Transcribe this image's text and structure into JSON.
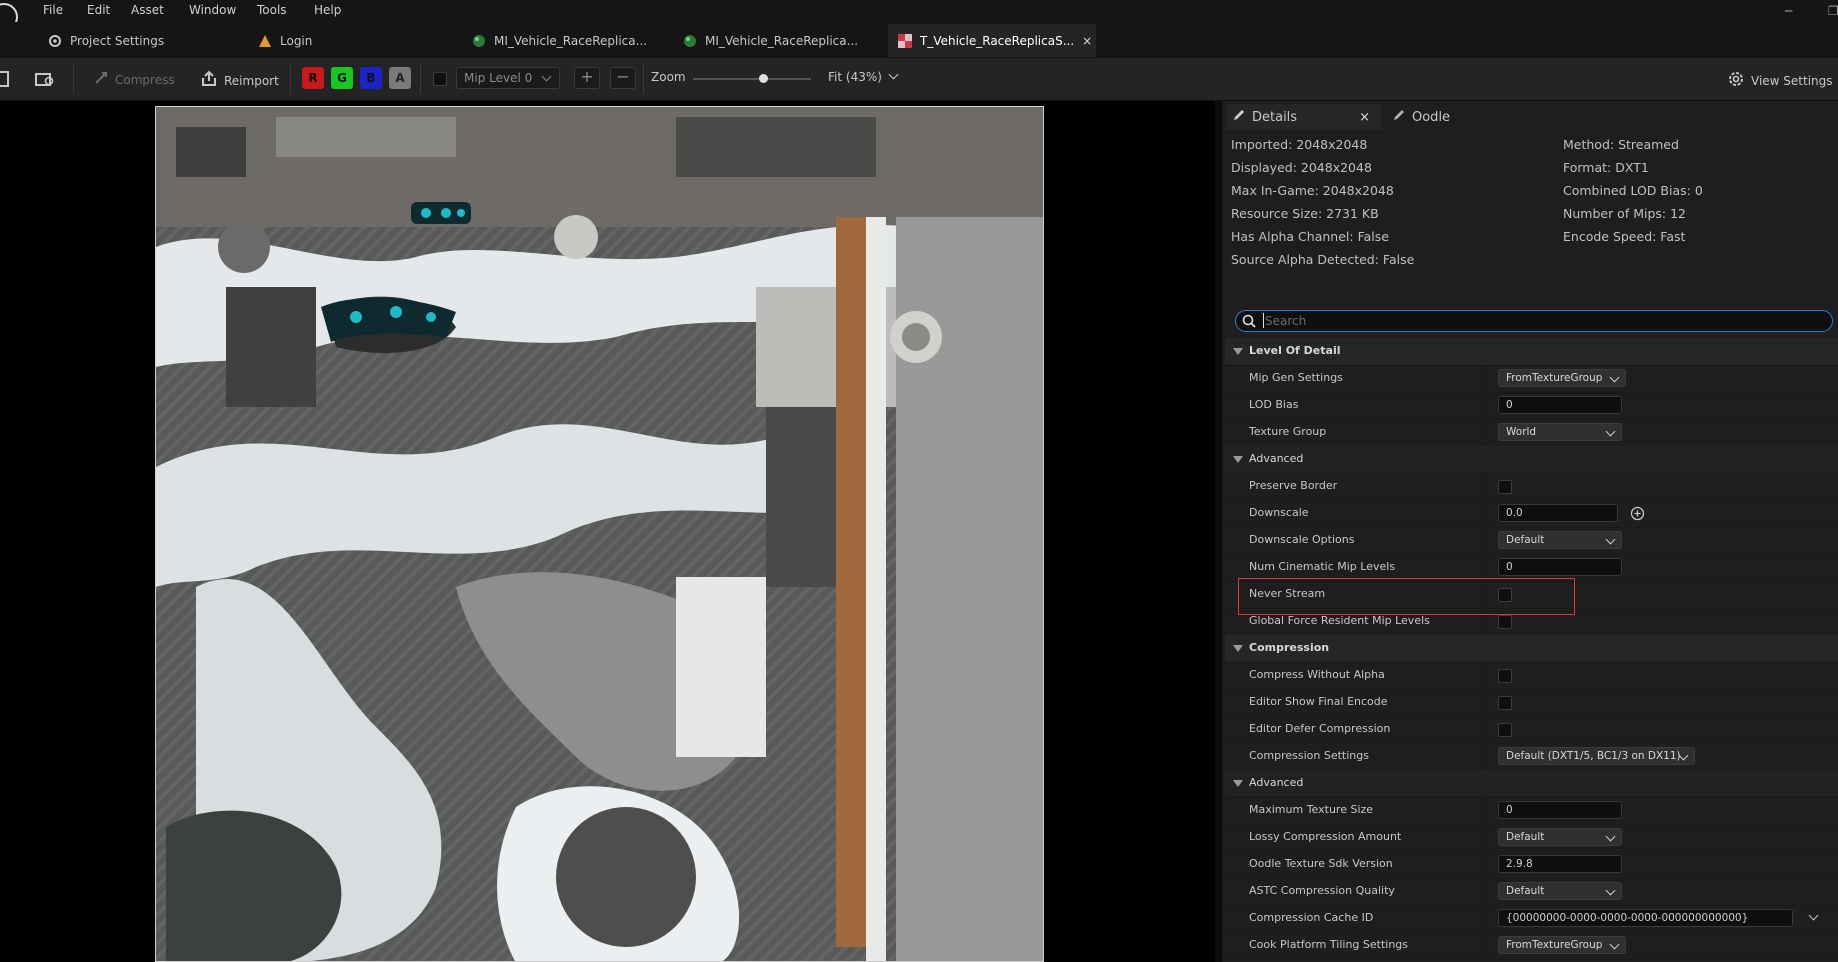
{
  "menu": {
    "items": [
      "File",
      "Edit",
      "Asset",
      "Window",
      "Tools",
      "Help"
    ]
  },
  "tabs": [
    {
      "label": "Project Settings"
    },
    {
      "label": "Login"
    },
    {
      "label": "MI_Vehicle_RaceReplica..."
    },
    {
      "label": "MI_Vehicle_RaceReplica..."
    },
    {
      "label": "T_Vehicle_RaceReplicaS...",
      "close": "×"
    }
  ],
  "toolbar": {
    "compress": "Compress",
    "reimport": "Reimport",
    "channels": [
      "R",
      "G",
      "B",
      "A"
    ],
    "mip_level": "Mip Level 0",
    "zoom_label": "Zoom",
    "zoom_value": 0.6,
    "fit": "Fit (43%)",
    "view_settings": "View Settings"
  },
  "panel_tabs": {
    "details": "Details",
    "details_close": "×",
    "oodle": "Oodle"
  },
  "info": {
    "left": [
      "Imported: 2048x2048",
      "Displayed: 2048x2048",
      "Max In-Game: 2048x2048",
      "Resource Size: 2731 KB",
      "Has Alpha Channel: False",
      "Source Alpha Detected: False"
    ],
    "right": [
      "Method: Streamed",
      "Format: DXT1",
      "Combined LOD Bias: 0",
      "Number of Mips: 12",
      "Encode Speed: Fast"
    ]
  },
  "search": {
    "placeholder": "Search"
  },
  "sections": {
    "lod": "Level Of Detail",
    "lod_advanced": "Advanced",
    "compression": "Compression",
    "comp_advanced": "Advanced"
  },
  "properties": {
    "mip_gen_settings": {
      "label": "Mip Gen Settings",
      "value": "FromTextureGroup"
    },
    "lod_bias": {
      "label": "LOD Bias",
      "value": "0"
    },
    "texture_group": {
      "label": "Texture Group",
      "value": "World"
    },
    "preserve_border": {
      "label": "Preserve Border"
    },
    "downscale": {
      "label": "Downscale",
      "value": "0.0"
    },
    "downscale_options": {
      "label": "Downscale Options",
      "value": "Default"
    },
    "num_cinematic_mip_levels": {
      "label": "Num Cinematic Mip Levels",
      "value": "0"
    },
    "never_stream": {
      "label": "Never Stream"
    },
    "global_force_resident": {
      "label": "Global Force Resident Mip Levels"
    },
    "compress_without_alpha": {
      "label": "Compress Without Alpha"
    },
    "editor_show_final_encode": {
      "label": "Editor Show Final Encode"
    },
    "editor_defer_compression": {
      "label": "Editor Defer Compression"
    },
    "compression_settings": {
      "label": "Compression Settings",
      "value": "Default (DXT1/5, BC1/3 on DX11)"
    },
    "maximum_texture_size": {
      "label": "Maximum Texture Size",
      "value": "0"
    },
    "lossy_compression_amount": {
      "label": "Lossy Compression Amount",
      "value": "Default"
    },
    "oodle_sdk_version": {
      "label": "Oodle Texture Sdk Version",
      "value": "2.9.8"
    },
    "astc_quality": {
      "label": "ASTC Compression Quality",
      "value": "Default"
    },
    "compression_cache_id": {
      "label": "Compression Cache ID",
      "value": "{00000000-0000-0000-0000-000000000000}"
    },
    "cook_platform_tiling": {
      "label": "Cook Platform Tiling Settings",
      "value": "FromTextureGroup"
    }
  },
  "colors": {
    "accent": "#2a7fd4",
    "highlight": "#d63a3a",
    "r": "#c8191b",
    "g": "#19c81e",
    "b": "#1a24c8",
    "a": "#7a7a7a"
  }
}
